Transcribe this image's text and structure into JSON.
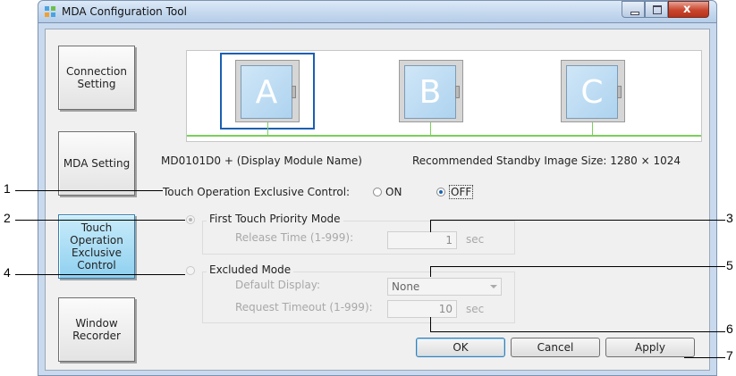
{
  "window": {
    "title": "MDA Configuration Tool",
    "icon": "app-icon",
    "controls": [
      "minimize-icon",
      "maximize-icon",
      "close-icon"
    ]
  },
  "nav": {
    "connection": "Connection\nSetting",
    "mda": "MDA Setting",
    "touch": "Touch\nOperation\nExclusive\nControl",
    "window": "Window\nRecorder"
  },
  "monitors": {
    "a": "A",
    "b": "B",
    "c": "C",
    "selected": "A"
  },
  "info": {
    "module": "MD0101D0 + (Display Module Name)",
    "recommended": "Recommended Standby Image Size: 1280 × 1024"
  },
  "touch_control": {
    "label": "Touch Operation Exclusive Control:",
    "on": "ON",
    "off": "OFF",
    "selected": "OFF"
  },
  "first_touch": {
    "label": "First Touch Priority Mode",
    "release_label": "Release Time (1-999):",
    "release_value": "1",
    "release_unit": "sec"
  },
  "excluded": {
    "label": "Excluded Mode",
    "default_label": "Default Display:",
    "default_value": "None",
    "timeout_label": "Request Timeout (1-999):",
    "timeout_value": "10",
    "timeout_unit": "sec"
  },
  "buttons": {
    "ok": "OK",
    "cancel": "Cancel",
    "apply": "Apply"
  },
  "callouts": [
    "1",
    "2",
    "3",
    "4",
    "5",
    "6",
    "7"
  ],
  "colors": {
    "accent": "#1a5fb4",
    "active_nav": "#8fd0ef"
  }
}
